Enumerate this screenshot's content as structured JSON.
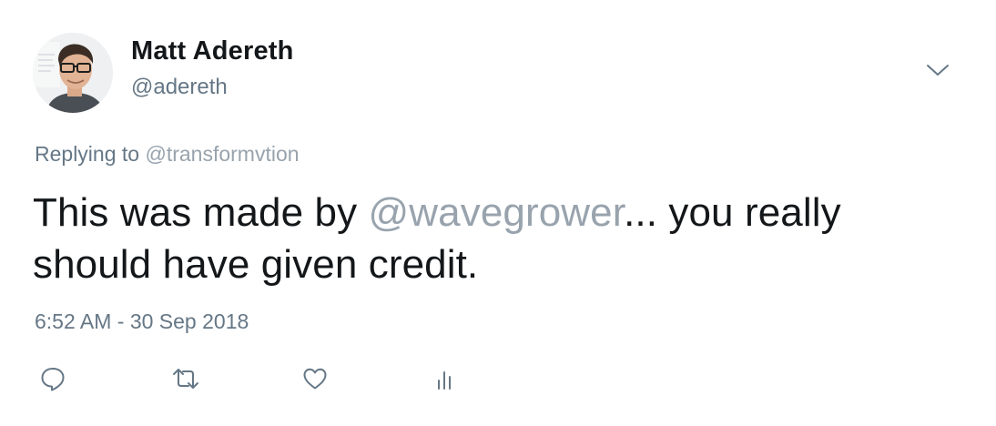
{
  "colors": {
    "text_primary": "#14171a",
    "text_secondary": "#657786",
    "mention": "#98a3ad",
    "icon": "#657786"
  },
  "author": {
    "display_name": "Matt Adereth",
    "handle": "@adereth",
    "avatar_icon": "profile-photo"
  },
  "reply_context": {
    "prefix": "Replying to ",
    "mention": "@transformvtion"
  },
  "tweet": {
    "text_before": "This was made by ",
    "mention": "@wavegrower",
    "text_after": "... you really should have given credit.",
    "timestamp": "6:52 AM - 30 Sep 2018"
  },
  "menu": {
    "icon": "chevron-down-icon"
  },
  "actions": [
    {
      "name": "reply",
      "icon": "speech-bubble-icon"
    },
    {
      "name": "retweet",
      "icon": "retweet-icon"
    },
    {
      "name": "like",
      "icon": "heart-icon"
    },
    {
      "name": "analytics",
      "icon": "bar-chart-icon"
    }
  ]
}
